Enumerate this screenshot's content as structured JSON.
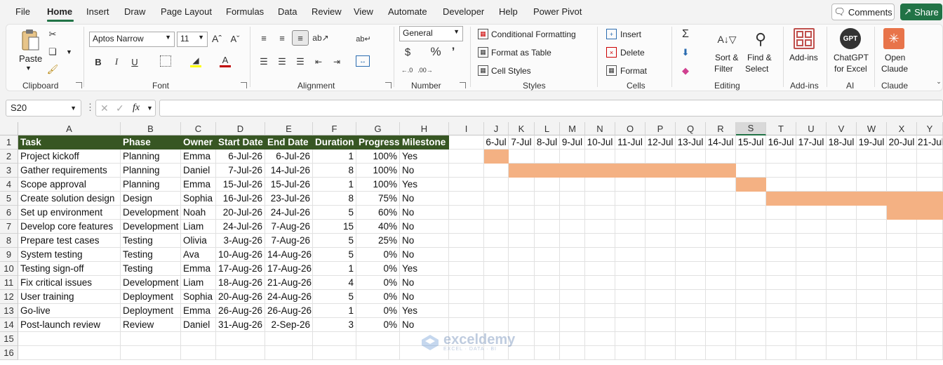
{
  "menu": {
    "tabs": [
      "File",
      "Home",
      "Insert",
      "Draw",
      "Page Layout",
      "Formulas",
      "Data",
      "Review",
      "View",
      "Automate",
      "Developer",
      "Help",
      "Power Pivot"
    ],
    "active": "Home",
    "comments_label": "Comments",
    "share_label": "Share"
  },
  "ribbon": {
    "clipboard": {
      "group": "Clipboard",
      "paste": "Paste"
    },
    "font": {
      "group": "Font",
      "name": "Aptos Narrow",
      "size": "11"
    },
    "alignment": {
      "group": "Alignment"
    },
    "number": {
      "group": "Number",
      "format": "General"
    },
    "styles": {
      "group": "Styles",
      "conditional": "Conditional Formatting",
      "table": "Format as Table",
      "cell": "Cell Styles"
    },
    "cells": {
      "group": "Cells",
      "insert": "Insert",
      "delete": "Delete",
      "format": "Format"
    },
    "editing": {
      "group": "Editing",
      "sort1": "Sort &",
      "sort2": "Filter",
      "find1": "Find &",
      "find2": "Select"
    },
    "addins": {
      "group": "Add-ins",
      "label": "Add-ins"
    },
    "ai": {
      "group": "AI",
      "label1": "ChatGPT",
      "label2": "for Excel",
      "logo": "GPT"
    },
    "claude": {
      "group": "Claude",
      "label1": "Open",
      "label2": "Claude"
    }
  },
  "formula_bar": {
    "name_box": "S20",
    "fx": "fx",
    "formula": ""
  },
  "sheet": {
    "columns": [
      "A",
      "B",
      "C",
      "D",
      "E",
      "F",
      "G",
      "H",
      "I",
      "J",
      "K",
      "L",
      "M",
      "N",
      "O",
      "P",
      "Q",
      "R",
      "S",
      "T",
      "U",
      "V",
      "W",
      "X",
      "Y"
    ],
    "selected_column": "S",
    "rows": [
      "1",
      "2",
      "3",
      "4",
      "5",
      "6",
      "7",
      "8",
      "9",
      "10",
      "11",
      "12",
      "13",
      "14",
      "15",
      "16"
    ],
    "headers": [
      "Task",
      "Phase",
      "Owner",
      "Start Date",
      "End Date",
      "Duration",
      "Progress",
      "Milestone"
    ],
    "timeline": [
      "6-Jul",
      "7-Jul",
      "8-Jul",
      "9-Jul",
      "10-Jul",
      "11-Jul",
      "12-Jul",
      "13-Jul",
      "14-Jul",
      "15-Jul",
      "16-Jul",
      "17-Jul",
      "18-Jul",
      "19-Jul",
      "20-Jul",
      "21-Jul"
    ],
    "data": [
      [
        "Project kickoff",
        "Planning",
        "Emma",
        "6-Jul-26",
        "6-Jul-26",
        "1",
        "100%",
        "Yes"
      ],
      [
        "Gather requirements",
        "Planning",
        "Daniel",
        "7-Jul-26",
        "14-Jul-26",
        "8",
        "100%",
        "No"
      ],
      [
        "Scope approval",
        "Planning",
        "Emma",
        "15-Jul-26",
        "15-Jul-26",
        "1",
        "100%",
        "Yes"
      ],
      [
        "Create solution design",
        "Design",
        "Sophia",
        "16-Jul-26",
        "23-Jul-26",
        "8",
        "75%",
        "No"
      ],
      [
        "Set up environment",
        "Development",
        "Noah",
        "20-Jul-26",
        "24-Jul-26",
        "5",
        "60%",
        "No"
      ],
      [
        "Develop core features",
        "Development",
        "Liam",
        "24-Jul-26",
        "7-Aug-26",
        "15",
        "40%",
        "No"
      ],
      [
        "Prepare test cases",
        "Testing",
        "Olivia",
        "3-Aug-26",
        "7-Aug-26",
        "5",
        "25%",
        "No"
      ],
      [
        "System testing",
        "Testing",
        "Ava",
        "10-Aug-26",
        "14-Aug-26",
        "5",
        "0%",
        "No"
      ],
      [
        "Testing sign-off",
        "Testing",
        "Emma",
        "17-Aug-26",
        "17-Aug-26",
        "1",
        "0%",
        "Yes"
      ],
      [
        "Fix critical issues",
        "Development",
        "Liam",
        "18-Aug-26",
        "21-Aug-26",
        "4",
        "0%",
        "No"
      ],
      [
        "User training",
        "Deployment",
        "Sophia",
        "20-Aug-26",
        "24-Aug-26",
        "5",
        "0%",
        "No"
      ],
      [
        "Go-live",
        "Deployment",
        "Emma",
        "26-Aug-26",
        "26-Aug-26",
        "1",
        "0%",
        "Yes"
      ],
      [
        "Post-launch review",
        "Review",
        "Daniel",
        "31-Aug-26",
        "2-Sep-26",
        "3",
        "0%",
        "No"
      ]
    ],
    "gantt_color": "#f4b183",
    "header_color": "#375623"
  },
  "watermark": {
    "name": "exceldemy",
    "tagline": "EXCEL · DATA · BI"
  }
}
